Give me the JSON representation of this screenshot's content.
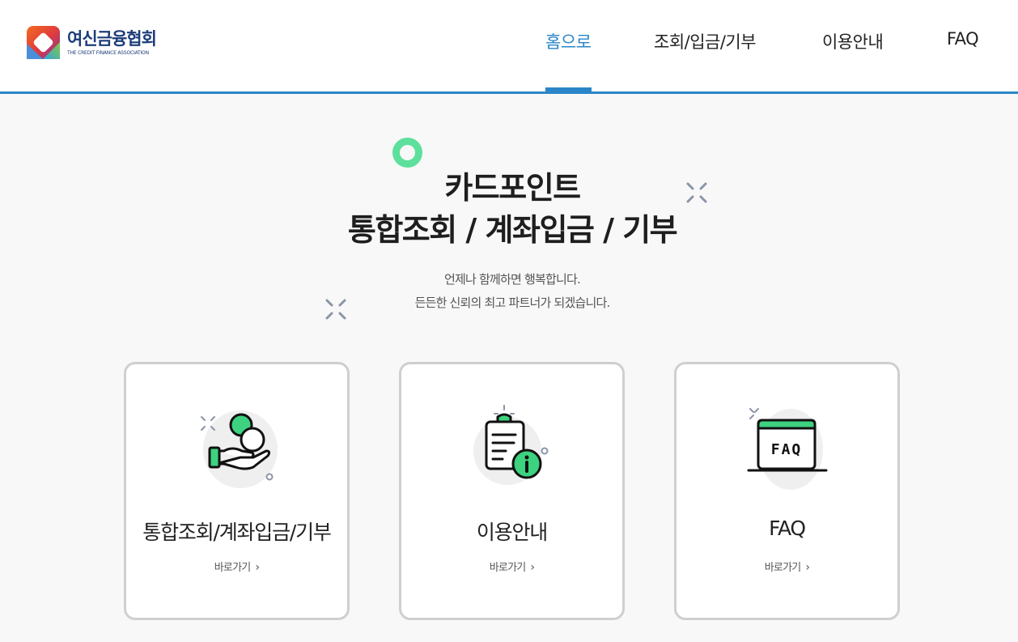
{
  "header": {
    "logo_ko": "여신금융협회",
    "logo_en": "THE CREDIT FINANCE ASSOCIATION",
    "nav": [
      {
        "label": "홈으로",
        "active": true
      },
      {
        "label": "조회/입금/기부",
        "active": false
      },
      {
        "label": "이용안내",
        "active": false
      },
      {
        "label": "FAQ",
        "active": false
      }
    ]
  },
  "hero": {
    "title_line1": "카드포인트",
    "title_line2": "통합조회 / 계좌입금 / 기부",
    "sub_line1": "언제나 함께하면 행복합니다.",
    "sub_line2": "든든한 신뢰의 최고 파트너가 되겠습니다."
  },
  "cards": [
    {
      "title": "통합조회/계좌입금/기부",
      "link": "바로가기",
      "icon": "coin-hand-icon"
    },
    {
      "title": "이용안내",
      "link": "바로가기",
      "icon": "clipboard-info-icon"
    },
    {
      "title": "FAQ",
      "link": "바로가기",
      "icon": "faq-board-icon",
      "icon_text": "FAQ"
    }
  ],
  "colors": {
    "accent": "#2a86c8",
    "green": "#3dd27f",
    "logo_navy": "#1c3d7a"
  }
}
